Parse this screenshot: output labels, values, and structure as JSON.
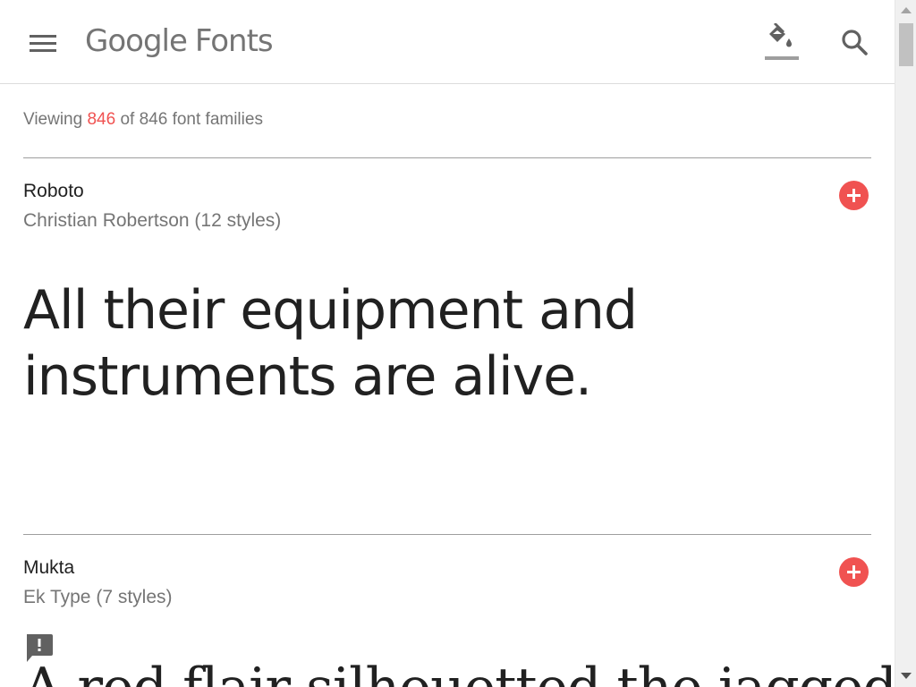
{
  "header": {
    "logo_google": "Google",
    "logo_fonts": "Fonts",
    "menu_icon": "menu-icon",
    "theme_icon": "format-color-fill-icon",
    "search_icon": "search-icon"
  },
  "status": {
    "viewing_prefix": "Viewing ",
    "viewing_count": "846",
    "viewing_suffix": " of 846 font families"
  },
  "fonts": [
    {
      "name": "Roboto",
      "meta": "Christian Robertson (12 styles)",
      "sample": "All their equipment and instruments are alive."
    },
    {
      "name": "Mukta",
      "meta": "Ek Type (7 styles)",
      "sample": "A red flair silhouetted the jagged edge of a wing."
    }
  ],
  "colors": {
    "accent": "#f05251",
    "text_primary": "#212121",
    "text_secondary": "#757575"
  }
}
